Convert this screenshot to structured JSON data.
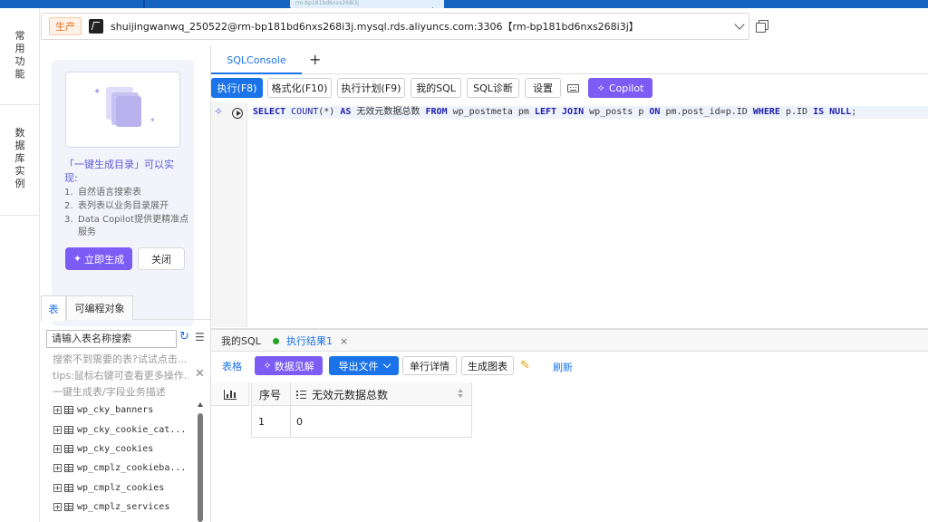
{
  "browser": {
    "tab_title": "rm-bp181bd6nxs268i3j"
  },
  "rail": {
    "items": [
      [
        "常",
        "用",
        "功",
        "能"
      ],
      [
        "数",
        "据",
        "库",
        "实",
        "例"
      ]
    ]
  },
  "connection": {
    "env": "生产",
    "text": "shuijingwanwq_250522@rm-bp181bd6nxs268i3j.mysql.rds.aliyuncs.com:3306【rm-bp181bd6nxs268i3j】"
  },
  "promo": {
    "title": "「一键生成目录」可以实现:",
    "items": [
      {
        "num": "1.",
        "text": "自然语言搜索表"
      },
      {
        "num": "2.",
        "text": "表列表以业务目录展开"
      },
      {
        "num": "3.",
        "text": "Data Copilot提供更精准点服务"
      }
    ],
    "generate_label": "立即生成",
    "close_label": "关闭"
  },
  "left_tabs": {
    "tables": "表",
    "programmable": "可编程对象"
  },
  "search": {
    "placeholder": "请输入表名称搜索"
  },
  "hints": {
    "not_found": "搜索不到需要的表?试试点击...",
    "tips": "tips:鼠标右键可查看更多操作...",
    "generate": "一键生成表/字段业务描述"
  },
  "tables": [
    "wp_cky_banners",
    "wp_cky_cookie_cat...",
    "wp_cky_cookies",
    "wp_cmplz_cookieba...",
    "wp_cmplz_cookies",
    "wp_cmplz_services"
  ],
  "editor_tab": {
    "label": "SQLConsole",
    "add": "+"
  },
  "toolbar": {
    "execute": "执行(F8)",
    "format": "格式化(F10)",
    "plan": "执行计划(F9)",
    "my_sql": "我的SQL",
    "diagnose": "SQL诊断",
    "settings": "设置",
    "copilot": "Copilot"
  },
  "sql": {
    "select": "SELECT",
    "count": "COUNT",
    "count_args": "(*)",
    "as": "AS",
    "alias": "无效元数据总数",
    "from": "FROM",
    "t1": "wp_postmeta pm",
    "left_join": "LEFT JOIN",
    "t2": "wp_posts p",
    "on": "ON",
    "cond": "pm.post_id=p.ID",
    "where": "WHERE",
    "col": "p.ID",
    "is_null": "IS NULL",
    "end": ";"
  },
  "results": {
    "tab_mysql": "我的SQL",
    "tab_result": "执行结果1",
    "tab_close": "×",
    "view_table": "表格",
    "insight": "数据见解",
    "export": "导出文件",
    "row_detail": "单行详情",
    "gen_chart": "生成图表",
    "refresh": "刷新",
    "columns": [
      "序号",
      "无效元数据总数"
    ],
    "rows": [
      [
        "1",
        "0"
      ]
    ]
  }
}
